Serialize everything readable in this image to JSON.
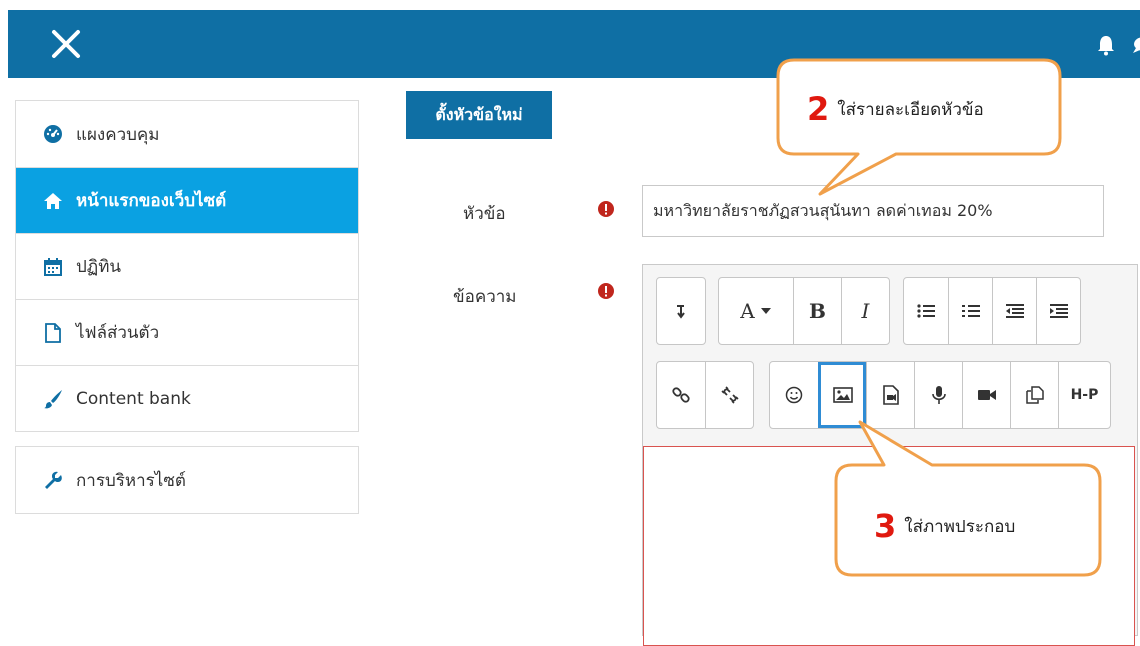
{
  "topbar": {
    "bg_color": "#0f6fa4",
    "icons": [
      "close-icon",
      "bell-icon",
      "chat-icon"
    ]
  },
  "sidebar": {
    "items": [
      {
        "label": "แผงควบคุม",
        "icon": "dashboard-icon"
      },
      {
        "label": "หน้าแรกของเว็บไซต์",
        "icon": "home-icon",
        "active": true
      },
      {
        "label": "ปฏิทิน",
        "icon": "calendar-icon"
      },
      {
        "label": "ไฟล์ส่วนตัว",
        "icon": "file-icon"
      },
      {
        "label": "Content bank",
        "icon": "paintbrush-icon"
      }
    ],
    "admin": {
      "label": "การบริหารไซต์",
      "icon": "wrench-icon"
    },
    "active_color": "#0aa1e2"
  },
  "form": {
    "new_topic_button": "ตั้งหัวข้อใหม่",
    "subject_label": "หัวข้อ",
    "subject_value": "มหาวิทยาลัยราชภัฏสวนสุนันทา ลดค่าเทอม 20%",
    "message_label": "ข้อความ"
  },
  "toolbar": {
    "row1": [
      "expand-icon",
      "font-color-icon",
      "bold-icon",
      "italic-icon",
      "unordered-list-icon",
      "ordered-list-icon",
      "outdent-icon",
      "indent-icon"
    ],
    "font_label": "A",
    "bold_label": "B",
    "italic_label": "I",
    "row2": [
      "link-icon",
      "unlink-icon",
      "emoji-icon",
      "image-icon",
      "media-icon",
      "record-audio-icon",
      "record-video-icon",
      "manage-files-icon",
      "h5p-icon"
    ],
    "h5p_label": "H-P"
  },
  "callouts": [
    {
      "number": "2",
      "text": "ใส่รายละเอียดหัวข้อ",
      "border_color": "#f0a04b"
    },
    {
      "number": "3",
      "text": "ใส่ภาพประกอบ",
      "border_color": "#f0a04b"
    }
  ]
}
